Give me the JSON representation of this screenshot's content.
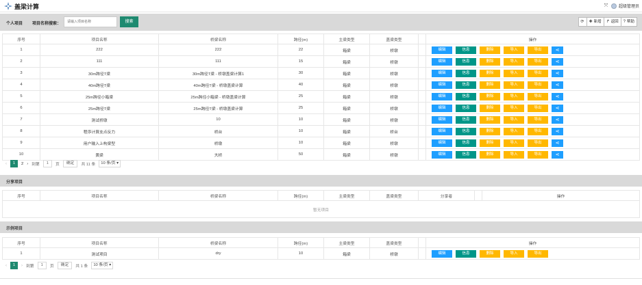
{
  "header": {
    "title": "盖梁计算",
    "user": "超级管理员"
  },
  "personal": {
    "section_label": "个人项目",
    "search_label": "项目名称搜索：",
    "search_placeholder": "请输入项目名称",
    "search_button": "搜索",
    "toolbar": {
      "refresh": "",
      "add": "新增",
      "back": "返回",
      "help": "帮助"
    },
    "columns": [
      "序号",
      "项目名称",
      "桥梁名称",
      "跨径(m)",
      "主梁类型",
      "盖梁类型",
      "",
      "操作"
    ],
    "rows": [
      {
        "no": "1",
        "project": "222",
        "bridge": "222",
        "span": "22",
        "girder": "箱梁",
        "cap": "桥墩"
      },
      {
        "no": "2",
        "project": "111",
        "bridge": "111",
        "span": "15",
        "girder": "箱梁",
        "cap": "桥墩"
      },
      {
        "no": "3",
        "project": "30m跨径T梁",
        "bridge": "30m跨径T梁 - 桥墩盖梁计算1",
        "span": "30",
        "girder": "箱梁",
        "cap": "桥墩"
      },
      {
        "no": "4",
        "project": "40m跨径T梁",
        "bridge": "40m跨径T梁 - 桥墩盖梁计算",
        "span": "40",
        "girder": "箱梁",
        "cap": "桥墩"
      },
      {
        "no": "5",
        "project": "25m跨径小箱梁",
        "bridge": "25m跨径小箱梁 - 桥墩盖梁计算",
        "span": "25",
        "girder": "箱梁",
        "cap": "桥墩"
      },
      {
        "no": "6",
        "project": "25m跨径T梁",
        "bridge": "25m跨径T梁 - 桥墩盖梁计算",
        "span": "25",
        "girder": "箱梁",
        "cap": "桥墩"
      },
      {
        "no": "7",
        "project": "测试桥墩",
        "bridge": "10",
        "span": "10",
        "girder": "箱梁",
        "cap": "桥墩"
      },
      {
        "no": "8",
        "project": "程序计算支点反力",
        "bridge": "桥台",
        "span": "10",
        "girder": "箱梁",
        "cap": "桥台"
      },
      {
        "no": "9",
        "project": "用户输入上构梁型",
        "bridge": "桥墩",
        "span": "10",
        "girder": "箱梁",
        "cap": "桥墩"
      },
      {
        "no": "10",
        "project": "黄梁",
        "bridge": "大桥",
        "span": "50",
        "girder": "箱梁",
        "cap": "桥墩"
      }
    ],
    "ops": {
      "edit": "编辑",
      "info": "信息",
      "del": "删除",
      "imp": "导入",
      "exp": "导出"
    },
    "pager": {
      "prev": "‹",
      "page1": "1",
      "page2": "2",
      "next": "›",
      "goto": "到第",
      "page_value": "1",
      "page_unit": "页",
      "confirm": "确定",
      "total": "共 11 条",
      "per_page": "10 条/页"
    }
  },
  "shared": {
    "title": "分享项目",
    "columns": [
      "序号",
      "项目名称",
      "桥梁名称",
      "跨径(m)",
      "主梁类型",
      "盖梁类型",
      "分享者",
      "",
      "操作"
    ],
    "empty": "暂无项目"
  },
  "example": {
    "title": "示例项目",
    "columns": [
      "序号",
      "项目名称",
      "桥梁名称",
      "跨径(m)",
      "主梁类型",
      "盖梁类型",
      "",
      "操作"
    ],
    "rows": [
      {
        "no": "1",
        "project": "测试项目",
        "bridge": "dry",
        "span": "10",
        "girder": "箱梁",
        "cap": "桥墩"
      }
    ],
    "pager": {
      "prev": "‹",
      "page1": "1",
      "next": "›",
      "goto": "到第",
      "page_value": "1",
      "page_unit": "页",
      "confirm": "确定",
      "total": "共 1 条",
      "per_page": "10 条/页"
    }
  },
  "colors": {
    "primary": "#1f8a70",
    "blue": "#1e9fff",
    "teal": "#009688",
    "orange": "#ffb800",
    "bar": "#d9d9d9"
  }
}
